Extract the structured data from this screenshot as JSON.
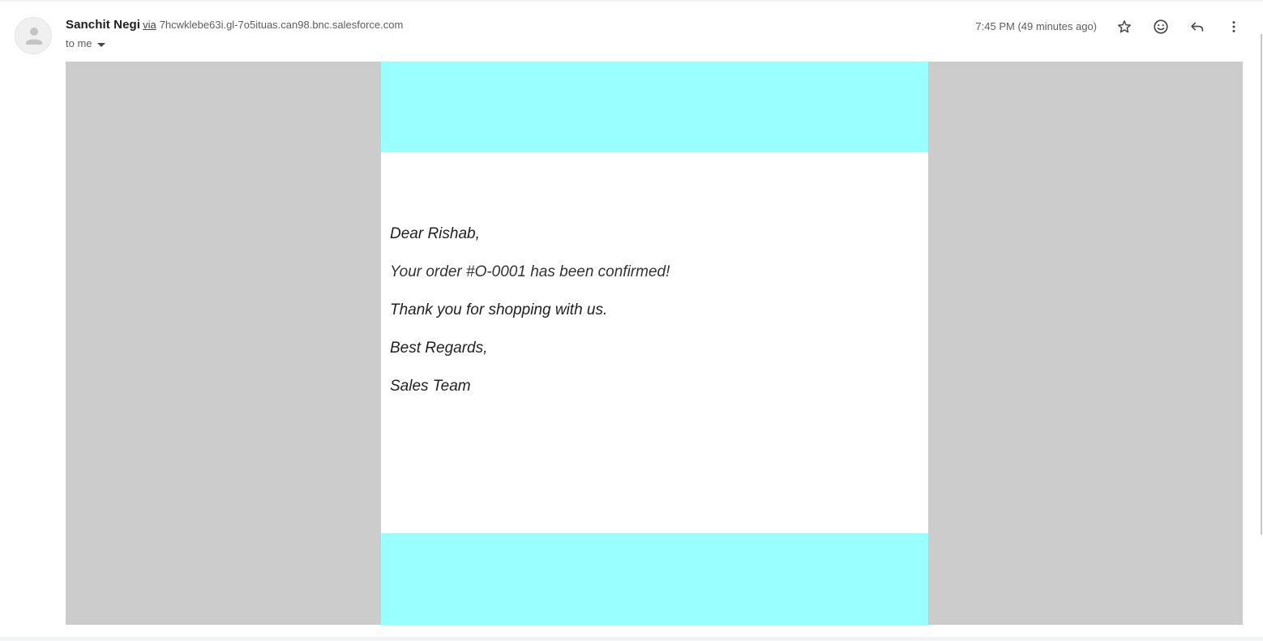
{
  "header": {
    "sender_name": "Sanchit Negi",
    "via_label": "via",
    "via_domain": "7hcwklebe63i.gl-7o5ituas.can98.bnc.salesforce.com",
    "recipient_label": "to me",
    "timestamp": "7:45 PM (49 minutes ago)"
  },
  "actions": {
    "star_icon": "star-icon",
    "emoji_icon": "emoji-reaction-icon",
    "reply_icon": "reply-icon",
    "more_icon": "more-vert-icon"
  },
  "email": {
    "greeting": "Dear Rishab,",
    "confirmation": "Your order #O-0001 has been confirmed!",
    "thanks": "Thank you for shopping with us.",
    "closing": "Best Regards,",
    "signature": "Sales Team"
  },
  "colors": {
    "band": "#99ffff",
    "backdrop": "#cccccc"
  }
}
